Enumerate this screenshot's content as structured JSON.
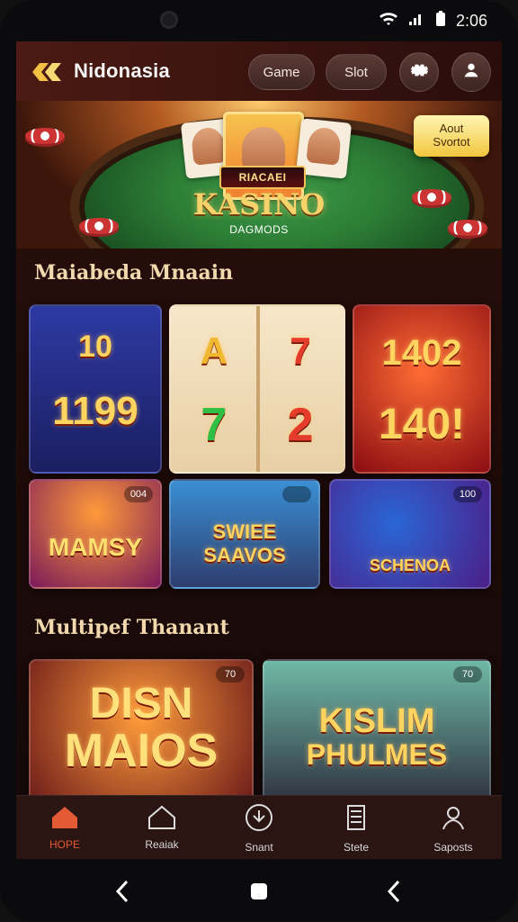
{
  "status": {
    "time": "2:06"
  },
  "header": {
    "brand": "Nidonasia",
    "buttons": {
      "game": "Game",
      "slot": "Slot"
    }
  },
  "hero": {
    "top_label": "RIACAEI",
    "title": "KASINO",
    "subtitle": "DAGMODS",
    "tag_line1": "Aout",
    "tag_line2": "Svortot"
  },
  "sections": {
    "first": "Maiabeda Mnaain",
    "second": "Multipef Thanant"
  },
  "tiles_row1": {
    "t1_top": "10",
    "t1_bottom": "1199",
    "t2_left_top": "A",
    "t2_right_top": "7",
    "t2_left_bottom": "7",
    "t2_right_bottom": "2",
    "t3_top": "1402",
    "t3_bottom": "140!"
  },
  "tiles_row2": {
    "t1_label": "MAMSY",
    "t1_badge": "004",
    "t2_label_1": "SWIEE",
    "t2_label_2": "SAAVOS",
    "t2_badge": "",
    "t3_label": "SCHENOA",
    "t3_badge": "100"
  },
  "tiles_row3": {
    "t1_label_1": "DISN",
    "t1_label_2": "MAIOS",
    "t1_badge": "70",
    "t2_label_1": "KISLIM",
    "t2_label_2": "PHULMES",
    "t2_badge": "70"
  },
  "nav": {
    "items": [
      {
        "label": "HOPE"
      },
      {
        "label": "Reaiak"
      },
      {
        "label": "Snant"
      },
      {
        "label": "Stete"
      },
      {
        "label": "Saposts"
      }
    ]
  },
  "colors": {
    "accent": "#e45a35",
    "gold": "#ffd45f",
    "bg": "#1d0b09"
  },
  "icons": {
    "wifi": "wifi-icon",
    "signal": "signal-icon",
    "battery": "battery-icon"
  }
}
